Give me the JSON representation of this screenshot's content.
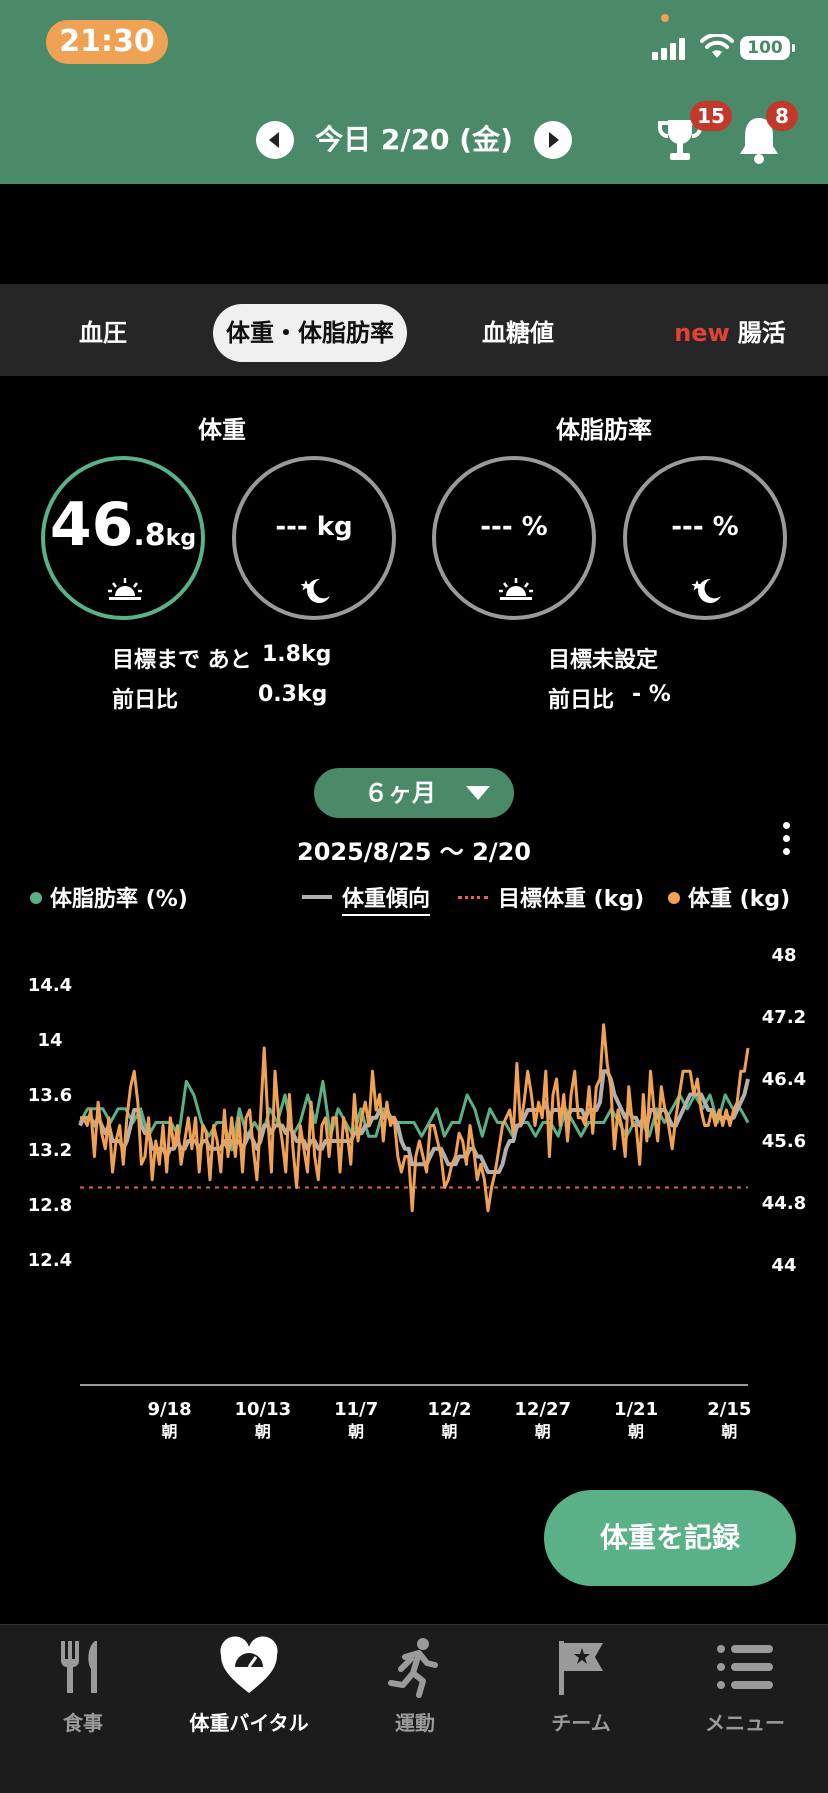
{
  "status_bar": {
    "time": "21:30",
    "battery": "100"
  },
  "header": {
    "date_title": "今日 2/20 (金)",
    "trophy_badge": "15",
    "bell_badge": "8"
  },
  "tabs": [
    {
      "label": "血圧"
    },
    {
      "label": "体重・体脂肪率"
    },
    {
      "label": "血糖値"
    },
    {
      "new": "new",
      "label": "腸活"
    }
  ],
  "weight": {
    "title": "体重",
    "morning": {
      "integer": "46",
      "decimal": ".8",
      "unit": "kg"
    },
    "evening": {
      "value": "--- kg"
    },
    "to_goal_label": "目標まで あと",
    "to_goal_value": "1.8kg",
    "diff_label": "前日比",
    "diff_value": "0.3kg"
  },
  "body_fat": {
    "title": "体脂肪率",
    "morning": {
      "value": "--- %"
    },
    "evening": {
      "value": "--- %"
    },
    "goal_status": "目標未設定",
    "diff_label": "前日比",
    "diff_value": "- %"
  },
  "period": {
    "label": "６ヶ月"
  },
  "range": "2025/8/25 〜 2/20",
  "legend": {
    "body_fat": "体脂肪率 (%)",
    "trend": "体重傾向",
    "target": "目標体重 (kg)",
    "weight": "体重 (kg)"
  },
  "colors": {
    "header": "#4a8a68",
    "body_fat_line": "#5ab087",
    "trend_line": "#b0b0b0",
    "target_line": "#e2615a",
    "weight_line": "#f0a254"
  },
  "chart_data": {
    "type": "line",
    "x_ticks": [
      {
        "date": "9/18",
        "sub": "朝"
      },
      {
        "date": "10/13",
        "sub": "朝"
      },
      {
        "date": "11/7",
        "sub": "朝"
      },
      {
        "date": "12/2",
        "sub": "朝"
      },
      {
        "date": "12/27",
        "sub": "朝"
      },
      {
        "date": "1/21",
        "sub": "朝"
      },
      {
        "date": "2/15",
        "sub": "朝"
      }
    ],
    "x_start": "2025-08-25",
    "x_end": "2026-02-20",
    "y_left": {
      "label": "",
      "ticks": [
        "14.4",
        "14",
        "13.6",
        "13.2",
        "12.8",
        "12.4"
      ],
      "range": [
        12.4,
        14.4
      ]
    },
    "y_right": {
      "label": "",
      "ticks": [
        "48",
        "47.2",
        "46.4",
        "45.6",
        "44.8",
        "44"
      ],
      "range": [
        44,
        48
      ]
    },
    "target_weight": 45.0,
    "series": [
      {
        "name": "体重 (kg)",
        "axis": "right",
        "values": [
          45.9,
          45.9,
          45.8,
          46.0,
          45.4,
          46.1,
          45.7,
          45.5,
          45.9,
          45.2,
          45.6,
          45.8,
          45.3,
          45.9,
          46.3,
          46.5,
          46.1,
          45.3,
          45.4,
          45.9,
          45.1,
          45.6,
          45.3,
          45.8,
          45.2,
          45.9,
          45.5,
          45.8,
          45.3,
          45.6,
          45.9,
          45.5,
          45.9,
          45.2,
          45.8,
          45.7,
          45.1,
          45.8,
          45.6,
          45.2,
          46.0,
          45.4,
          45.9,
          45.4,
          45.9,
          45.2,
          45.9,
          46.0,
          45.5,
          45.1,
          45.9,
          46.8,
          45.9,
          45.2,
          46.5,
          45.9,
          45.6,
          45.2,
          46.2,
          45.5,
          45.0,
          45.8,
          45.5,
          45.2,
          46.1,
          45.4,
          45.1,
          45.8,
          45.9,
          45.4,
          45.9,
          45.9,
          45.2,
          45.9,
          45.7,
          45.3,
          46.2,
          45.6,
          45.9,
          46.1,
          45.8,
          46.5,
          46.0,
          46.2,
          45.6,
          46.1,
          45.8,
          45.9,
          45.4,
          45.2,
          45.4,
          45.4,
          44.7,
          45.4,
          45.6,
          45.4,
          45.2,
          45.8,
          45.8,
          45.6,
          45.4,
          45.0,
          45.1,
          45.3,
          45.4,
          45.7,
          45.6,
          45.3,
          45.8,
          45.5,
          45.1,
          45.3,
          45.1,
          44.7,
          45.0,
          45.2,
          45.5,
          45.8,
          45.9,
          46.0,
          45.7,
          46.6,
          45.8,
          46.1,
          46.5,
          46.2,
          45.8,
          46.1,
          45.9,
          46.5,
          45.4,
          46.2,
          46.4,
          45.8,
          46.2,
          45.6,
          46.2,
          46.5,
          45.9,
          45.9,
          45.8,
          46.3,
          45.7,
          46.3,
          46.4,
          47.1,
          46.6,
          46.3,
          45.5,
          46.0,
          45.8,
          45.4,
          46.3,
          45.8,
          45.8,
          45.3,
          46.2,
          45.6,
          46.5,
          46.0,
          45.6,
          46.3,
          46.0,
          45.8,
          45.5,
          45.9,
          46.2,
          46.5,
          46.5,
          46.5,
          46.2,
          46.4,
          46.0,
          45.8,
          45.8,
          46.0,
          45.8,
          46.0,
          45.8,
          46.0,
          45.8,
          46.0,
          46.1,
          46.5,
          46.5,
          46.8
        ]
      },
      {
        "name": "体重傾向",
        "axis": "right",
        "values": [
          45.8,
          45.9,
          45.9,
          45.9,
          45.8,
          45.9,
          45.8,
          45.7,
          45.8,
          45.6,
          45.6,
          45.6,
          45.5,
          45.6,
          45.8,
          46.0,
          46.0,
          45.8,
          45.7,
          45.7,
          45.5,
          45.5,
          45.5,
          45.5,
          45.4,
          45.5,
          45.5,
          45.6,
          45.5,
          45.5,
          45.6,
          45.6,
          45.6,
          45.5,
          45.6,
          45.6,
          45.5,
          45.5,
          45.5,
          45.5,
          45.6,
          45.5,
          45.6,
          45.6,
          45.6,
          45.5,
          45.6,
          45.7,
          45.6,
          45.5,
          45.6,
          45.8,
          45.8,
          45.7,
          45.8,
          45.8,
          45.8,
          45.7,
          45.8,
          45.7,
          45.6,
          45.6,
          45.6,
          45.5,
          45.6,
          45.6,
          45.5,
          45.5,
          45.6,
          45.6,
          45.6,
          45.6,
          45.6,
          45.6,
          45.6,
          45.6,
          45.7,
          45.7,
          45.7,
          45.8,
          45.8,
          45.9,
          45.9,
          46.0,
          45.9,
          46.0,
          45.9,
          45.9,
          45.8,
          45.6,
          45.5,
          45.5,
          45.3,
          45.3,
          45.3,
          45.3,
          45.3,
          45.4,
          45.5,
          45.5,
          45.5,
          45.4,
          45.3,
          45.3,
          45.3,
          45.4,
          45.4,
          45.4,
          45.5,
          45.5,
          45.4,
          45.4,
          45.3,
          45.2,
          45.2,
          45.2,
          45.2,
          45.3,
          45.5,
          45.6,
          45.6,
          45.8,
          45.8,
          45.9,
          46.0,
          46.0,
          46.0,
          46.0,
          46.0,
          46.1,
          45.9,
          46.0,
          46.0,
          46.0,
          46.0,
          45.9,
          46.0,
          46.0,
          46.0,
          46.0,
          45.9,
          46.0,
          46.0,
          46.0,
          46.1,
          46.5,
          46.5,
          46.4,
          46.2,
          46.1,
          46.0,
          45.9,
          46.0,
          45.9,
          45.9,
          45.8,
          45.9,
          45.8,
          46.0,
          46.0,
          45.9,
          46.0,
          46.0,
          45.9,
          45.8,
          45.8,
          45.9,
          46.0,
          46.1,
          46.2,
          46.2,
          46.2,
          46.2,
          46.1,
          46.0,
          46.0,
          45.9,
          45.9,
          45.9,
          45.9,
          45.9,
          45.9,
          46.0,
          46.1,
          46.2,
          46.4
        ]
      },
      {
        "name": "体脂肪率 (%)",
        "axis": "left",
        "values": [
          13.4,
          13.5,
          13.5,
          13.5,
          13.4,
          13.5,
          13.5,
          13.4,
          13.5,
          13.3,
          13.4,
          13.4,
          13.4,
          13.3,
          13.7,
          13.6,
          13.4,
          13.3,
          13.4,
          13.4,
          13.2,
          13.5,
          13.3,
          13.4,
          13.3,
          13.5,
          13.4,
          13.6,
          13.3,
          13.4,
          13.6,
          13.4,
          13.7,
          13.3,
          13.5,
          13.4,
          13.3,
          13.5,
          13.3,
          13.3,
          13.5,
          13.4,
          13.4,
          13.4,
          13.4,
          13.3,
          13.4,
          13.5,
          13.3,
          13.4,
          13.4,
          13.6,
          13.5,
          13.3,
          13.5,
          13.4,
          13.4,
          13.3,
          13.4,
          13.4,
          13.3,
          13.4,
          13.4,
          13.3,
          13.5,
          13.4,
          13.3,
          13.4,
          13.4,
          13.4,
          13.5,
          13.4,
          13.3,
          13.4,
          13.4,
          13.3,
          13.5,
          13.4,
          13.5,
          13.6,
          13.5,
          13.6,
          13.5,
          13.6,
          13.4,
          13.6,
          13.5,
          13.5,
          13.4
        ]
      }
    ]
  },
  "record_button": "体重を記録",
  "bottom_nav": [
    {
      "label": "食事",
      "icon": "fork-knife-icon"
    },
    {
      "label": "体重バイタル",
      "icon": "heart-scale-icon"
    },
    {
      "label": "運動",
      "icon": "runner-icon"
    },
    {
      "label": "チーム",
      "icon": "flag-icon"
    },
    {
      "label": "メニュー",
      "icon": "menu-list-icon"
    }
  ]
}
